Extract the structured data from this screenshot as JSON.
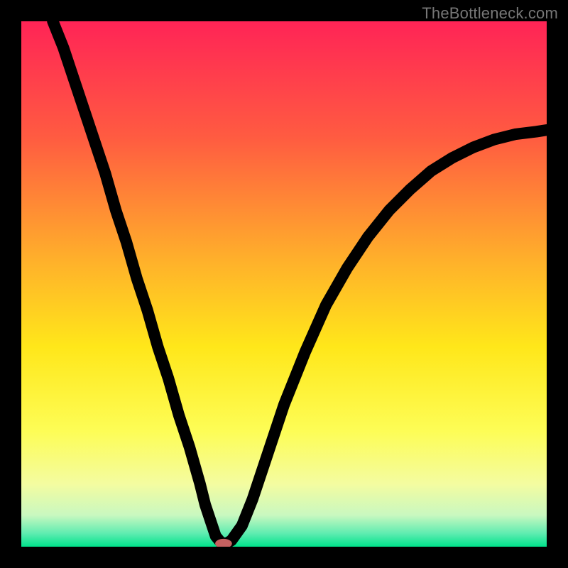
{
  "watermark": "TheBottleneck.com",
  "chart_data": {
    "type": "line",
    "title": "",
    "xlabel": "",
    "ylabel": "",
    "xlim": [
      0,
      100
    ],
    "ylim": [
      0,
      100
    ],
    "gradient_stops": [
      {
        "offset": 0.0,
        "color": "#ff2456"
      },
      {
        "offset": 0.22,
        "color": "#ff5b41"
      },
      {
        "offset": 0.46,
        "color": "#ffb22a"
      },
      {
        "offset": 0.62,
        "color": "#ffe71a"
      },
      {
        "offset": 0.78,
        "color": "#fdfd56"
      },
      {
        "offset": 0.88,
        "color": "#f4fca0"
      },
      {
        "offset": 0.94,
        "color": "#c9f8c0"
      },
      {
        "offset": 0.975,
        "color": "#5eecb0"
      },
      {
        "offset": 1.0,
        "color": "#00e28b"
      }
    ],
    "series": [
      {
        "name": "bottleneck-curve",
        "x": [
          6,
          8,
          10,
          12,
          14,
          16,
          18,
          20,
          22,
          24,
          26,
          28,
          30,
          32,
          34,
          35,
          36,
          37,
          38,
          39,
          40,
          42,
          44,
          46,
          48,
          50,
          54,
          58,
          62,
          66,
          70,
          74,
          78,
          82,
          86,
          90,
          94,
          98,
          100
        ],
        "y": [
          100,
          95,
          89,
          83,
          77,
          71,
          64,
          58,
          51,
          45,
          38,
          32,
          25,
          19,
          12,
          8,
          5,
          2,
          0.8,
          0.6,
          1.2,
          4,
          9,
          15,
          21,
          27,
          37,
          46,
          53,
          59,
          64,
          68,
          71.5,
          74,
          76,
          77.5,
          78.5,
          79,
          79.3
        ]
      }
    ],
    "marker": {
      "x": 38.5,
      "y": 0.6,
      "rx": 1.6,
      "ry": 0.9,
      "color": "#c56060"
    }
  }
}
